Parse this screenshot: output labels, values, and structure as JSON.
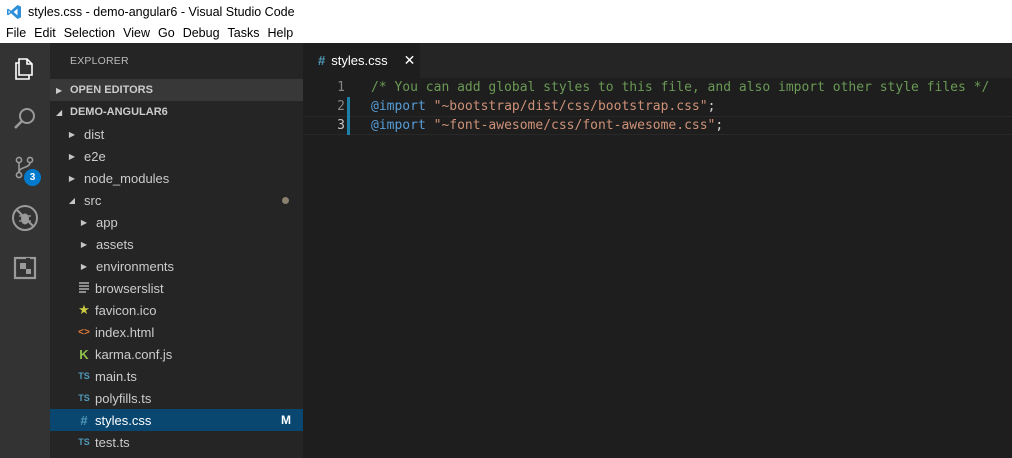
{
  "window": {
    "title": "styles.css - demo-angular6 - Visual Studio Code",
    "app_icon": "vscode-icon"
  },
  "menu": [
    "File",
    "Edit",
    "Selection",
    "View",
    "Go",
    "Debug",
    "Tasks",
    "Help"
  ],
  "activity_bar": {
    "items": [
      "explorer-icon",
      "search-icon",
      "source-control-icon",
      "debug-icon",
      "extensions-icon"
    ],
    "scm_badge": "3",
    "badge_color": "#007acc"
  },
  "sidebar": {
    "title": "EXPLORER",
    "open_editors": "OPEN EDITORS",
    "project": "DEMO-ANGULAR6",
    "tree": [
      {
        "label": "dist",
        "kind": "folder"
      },
      {
        "label": "e2e",
        "kind": "folder"
      },
      {
        "label": "node_modules",
        "kind": "folder"
      },
      {
        "label": "src",
        "kind": "folder-open"
      },
      {
        "label": "app",
        "kind": "folder"
      },
      {
        "label": "assets",
        "kind": "folder"
      },
      {
        "label": "environments",
        "kind": "folder"
      },
      {
        "label": "browserslist",
        "kind": "file",
        "icon": "lines-icon"
      },
      {
        "label": "favicon.ico",
        "kind": "file",
        "icon": "star-icon"
      },
      {
        "label": "index.html",
        "kind": "file",
        "icon": "html-icon"
      },
      {
        "label": "karma.conf.js",
        "kind": "file",
        "icon": "karma-icon"
      },
      {
        "label": "main.ts",
        "kind": "file",
        "icon": "ts-icon"
      },
      {
        "label": "polyfills.ts",
        "kind": "file",
        "icon": "ts-icon"
      },
      {
        "label": "styles.css",
        "kind": "file",
        "icon": "css-icon",
        "status": "M"
      },
      {
        "label": "test.ts",
        "kind": "file",
        "icon": "ts-icon"
      }
    ]
  },
  "icons": {
    "ts": "TS",
    "css": "#",
    "html": "<>",
    "karma": "K",
    "star": "★"
  },
  "editor": {
    "tab": {
      "icon": "#",
      "label": "styles.css",
      "close": "✕"
    },
    "lines": [
      {
        "num": "1",
        "parts": [
          {
            "t": "comment",
            "v": "/* You can add global styles to this file, and also import other style files */"
          }
        ]
      },
      {
        "num": "2",
        "parts": [
          {
            "t": "keyword",
            "v": "@import"
          },
          {
            "t": "punct",
            "v": " "
          },
          {
            "t": "string",
            "v": "\"~bootstrap/dist/css/bootstrap.css\""
          },
          {
            "t": "punct",
            "v": ";"
          }
        ]
      },
      {
        "num": "3",
        "parts": [
          {
            "t": "keyword",
            "v": "@import"
          },
          {
            "t": "punct",
            "v": " "
          },
          {
            "t": "string",
            "v": "\"~font-awesome/css/font-awesome.css\""
          },
          {
            "t": "punct",
            "v": ";"
          }
        ]
      }
    ]
  }
}
